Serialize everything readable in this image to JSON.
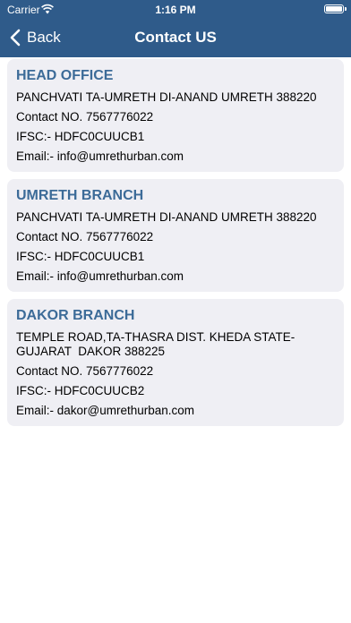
{
  "status_bar": {
    "carrier": "Carrier",
    "time": "1:16 PM"
  },
  "nav": {
    "back_label": "Back",
    "title": "Contact US"
  },
  "colors": {
    "header_bg": "#2f5b8a",
    "card_bg": "#efeff4",
    "title_color": "#3c6b98"
  },
  "branches": [
    {
      "name": "HEAD OFFICE",
      "address": "PANCHVATI TA-UMRETH DI-ANAND UMRETH 388220",
      "contact": "Contact NO. 7567776022",
      "ifsc": "IFSC:- HDFC0CUUCB1",
      "email": "Email:- info@umrethurban.com"
    },
    {
      "name": "UMRETH BRANCH",
      "address": "PANCHVATI TA-UMRETH DI-ANAND UMRETH 388220",
      "contact": "Contact NO. 7567776022",
      "ifsc": "IFSC:- HDFC0CUUCB1",
      "email": "Email:- info@umrethurban.com"
    },
    {
      "name": "DAKOR BRANCH",
      "address_line1": "TEMPLE ROAD,TA-THASRA DIST. KHEDA STATE-",
      "address_line2": "GUJARAT  DAKOR 388225",
      "contact": "Contact NO. 7567776022",
      "ifsc": "IFSC:- HDFC0CUUCB2",
      "email": "Email:- dakor@umrethurban.com"
    }
  ]
}
